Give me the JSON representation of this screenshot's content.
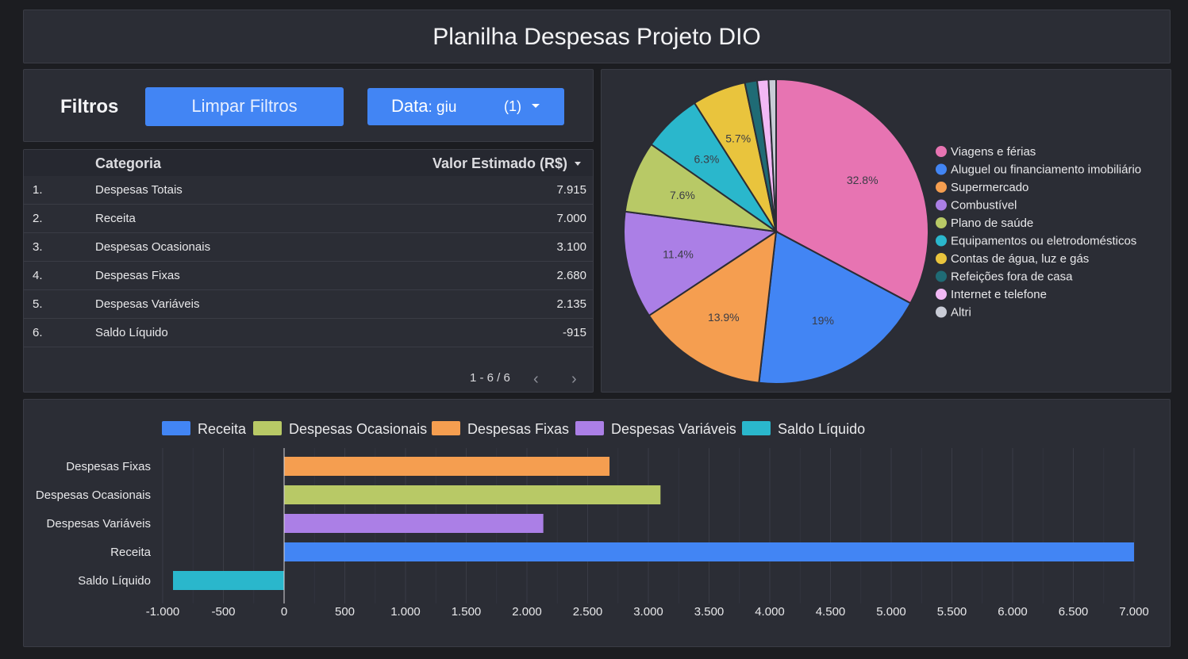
{
  "header": {
    "title": "Planilha Despesas Projeto DIO"
  },
  "filters": {
    "label": "Filtros",
    "clear_label": "Limpar Filtros",
    "date_label": "Data",
    "date_value": ": giu",
    "date_count": "(1)"
  },
  "table": {
    "col_category": "Categoria",
    "col_value": "Valor Estimado (R$)",
    "rows": [
      {
        "num": "1.",
        "category": "Despesas Totais",
        "value": "7.915"
      },
      {
        "num": "2.",
        "category": "Receita",
        "value": "7.000"
      },
      {
        "num": "3.",
        "category": "Despesas Ocasionais",
        "value": "3.100"
      },
      {
        "num": "4.",
        "category": "Despesas Fixas",
        "value": "2.680"
      },
      {
        "num": "5.",
        "category": "Despesas Variáveis",
        "value": "2.135"
      },
      {
        "num": "6.",
        "category": "Saldo Líquido",
        "value": "-915"
      }
    ],
    "pagination": "1 - 6 / 6"
  },
  "colors": {
    "accent": "#4285f4",
    "background": "#1c1d21",
    "panel": "#2b2d35"
  },
  "chart_data": [
    {
      "type": "pie",
      "categories": [
        "Viagens e férias",
        "Aluguel ou financiamento imobiliário",
        "Supermercado",
        "Combustível",
        "Plano de saúde",
        "Equipamentos ou eletrodomésticos",
        "Contas de água, luz e gás",
        "Refeições fora de casa",
        "Internet e telefone",
        "Altri"
      ],
      "values": [
        32.8,
        19.0,
        13.9,
        11.4,
        7.6,
        6.3,
        5.7,
        1.3,
        1.2,
        0.8
      ],
      "labels": [
        "32.8%",
        "19%",
        "13.9%",
        "11.4%",
        "7.6%",
        "6.3%",
        "5.7%",
        "",
        "",
        ""
      ],
      "colors": [
        "#e774b2",
        "#4285f4",
        "#f59e50",
        "#ab7fe6",
        "#b8c966",
        "#2ab7cc",
        "#e9c43d",
        "#1f6b75",
        "#f2b8f5",
        "#c9ccd6"
      ],
      "legend_position": "right"
    },
    {
      "type": "bar",
      "orientation": "horizontal",
      "categories": [
        "Despesas Fixas",
        "Despesas Ocasionais",
        "Despesas Variáveis",
        "Receita",
        "Saldo Líquido"
      ],
      "series": [
        {
          "name": "Receita",
          "color": "#4285f4"
        },
        {
          "name": "Despesas Ocasionais",
          "color": "#b8c966"
        },
        {
          "name": "Despesas Fixas",
          "color": "#f59e50"
        },
        {
          "name": "Despesas Variáveis",
          "color": "#ab7fe6"
        },
        {
          "name": "Saldo Líquido",
          "color": "#2ab7cc"
        }
      ],
      "values": [
        2680,
        3100,
        2135,
        7000,
        -915
      ],
      "bar_colors": [
        "#f59e50",
        "#b8c966",
        "#ab7fe6",
        "#4285f4",
        "#2ab7cc"
      ],
      "xlim": [
        -1000,
        7000
      ],
      "x_ticks": [
        -1000,
        -500,
        0,
        500,
        1000,
        1500,
        2000,
        2500,
        3000,
        3500,
        4000,
        4500,
        5000,
        5500,
        6000,
        6500,
        7000
      ],
      "x_tick_labels": [
        "-1.000",
        "-500",
        "0",
        "500",
        "1.000",
        "1.500",
        "2.000",
        "2.500",
        "3.000",
        "3.500",
        "4.000",
        "4.500",
        "5.000",
        "5.500",
        "6.000",
        "6.500",
        "7.000"
      ],
      "legend_position": "top",
      "grid": true
    }
  ]
}
